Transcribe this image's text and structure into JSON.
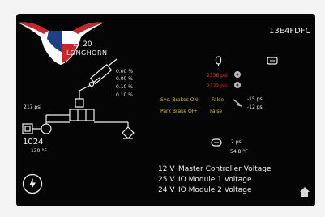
{
  "header": {
    "logo_line1": "LT 20",
    "logo_line2": "LONGHORN",
    "device_id": "13E4FDFC",
    "colors": {
      "flag_blue": "#1f3f8a",
      "flag_red": "#c8262c",
      "flag_white": "#ffffff"
    }
  },
  "hydraulics": {
    "pressure_left": "217 psi",
    "counter": "1024",
    "temperature": "130 °F",
    "valves": [
      "0.00 %",
      "0.00 %",
      "0.10 %",
      "0.10 %"
    ]
  },
  "brakes": {
    "pressure_1": "2336 psi",
    "pressure_2": "2322 psi",
    "svc_label": "Svc. Brakes ON",
    "svc_value": "False",
    "park_label": "Park Brake OFF",
    "park_value": "False",
    "readout_1": "-15 psi",
    "readout_2": "-12 psi",
    "colors": {
      "pressure": "#e23a33",
      "status": "#d6c52a"
    }
  },
  "transmission": {
    "pressure": "2 psi",
    "temperature": "54.8 °F"
  },
  "voltages": [
    {
      "value": "12 V",
      "label": "Master Controller Voltage"
    },
    {
      "value": "25 V",
      "label": "IO Module 1 Voltage"
    },
    {
      "value": "24 V",
      "label": "IO Module 2 Voltage"
    }
  ],
  "icons": {
    "power": "power-icon",
    "home": "home-icon",
    "gauge": "gauge-icon",
    "battery": "battery-icon",
    "brake": "brake-pedal-icon",
    "transmission": "transmission-icon"
  }
}
